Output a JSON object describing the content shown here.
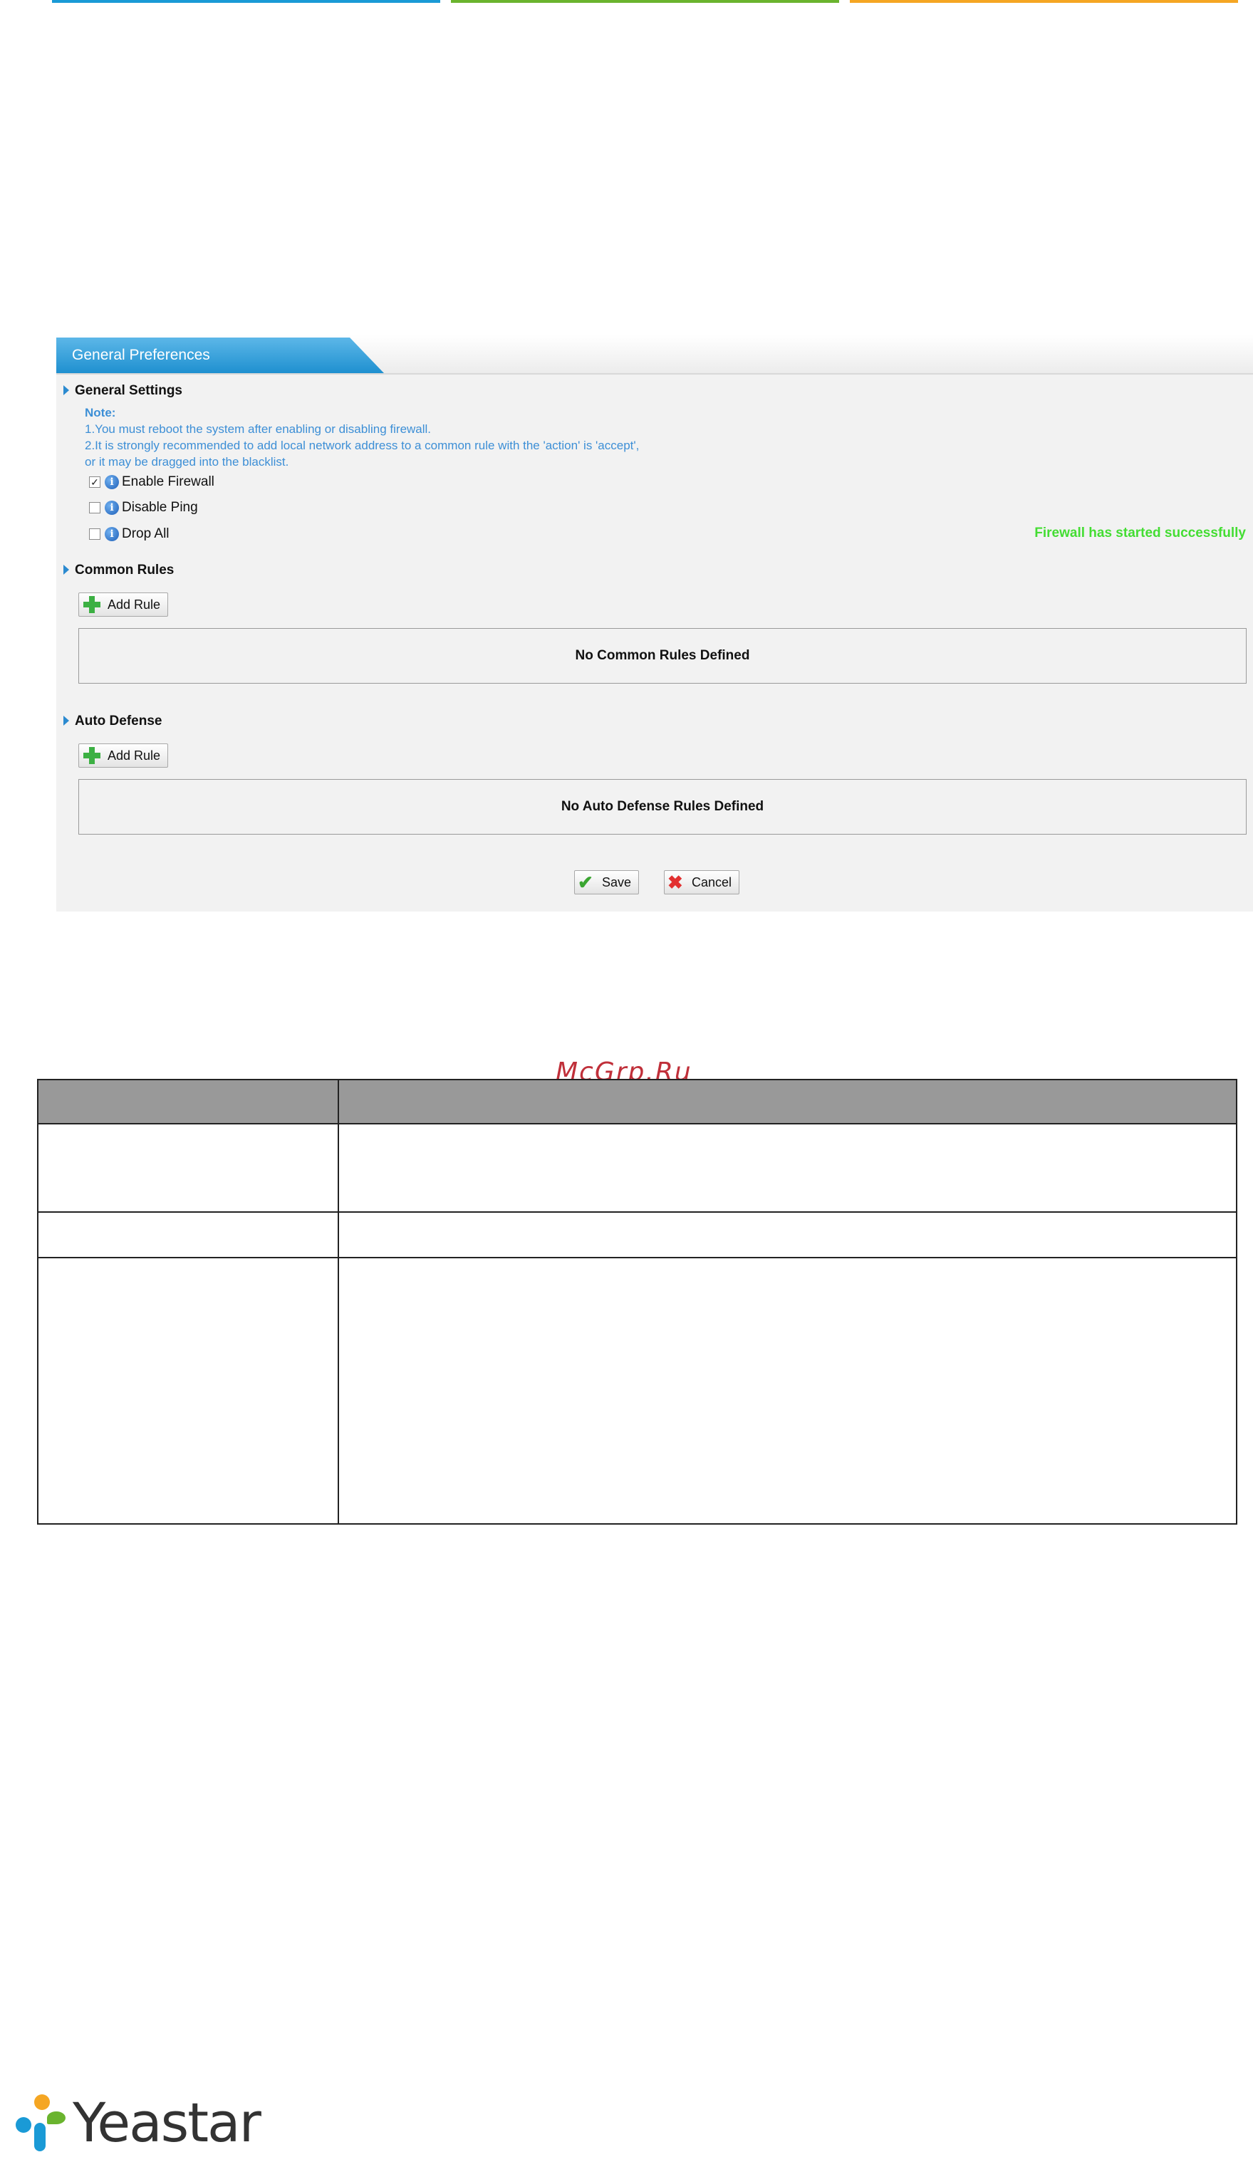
{
  "panel": {
    "tab_label": "General Preferences",
    "general_settings": {
      "title": "General Settings",
      "note_title": "Note:",
      "note_lines": [
        "1.You must reboot the system after enabling or disabling firewall.",
        "2.It is strongly recommended to add local network address to a common rule with the 'action' is 'accept',",
        "or it may be dragged into the blacklist."
      ],
      "options": [
        {
          "label": "Enable Firewall",
          "checked": true
        },
        {
          "label": "Disable Ping",
          "checked": false
        },
        {
          "label": "Drop All",
          "checked": false
        }
      ],
      "status": "Firewall has started successfully"
    },
    "common_rules": {
      "title": "Common Rules",
      "add_label": "Add Rule",
      "empty_text": "No Common Rules Defined"
    },
    "auto_defense": {
      "title": "Auto Defense",
      "add_label": "Add Rule",
      "empty_text": "No Auto Defense Rules Defined"
    },
    "save_label": "Save",
    "cancel_label": "Cancel"
  },
  "watermark": "McGrp.Ru",
  "logo": {
    "text": "Yeastar",
    "colors": {
      "blue": "#1a9ad6",
      "green": "#6ab42e",
      "orange": "#f5a623"
    }
  },
  "colors": {
    "accent_blue": "#1f90d0",
    "note_blue": "#3d8fd6",
    "status_green": "#44dd33",
    "table_header": "#999999"
  }
}
